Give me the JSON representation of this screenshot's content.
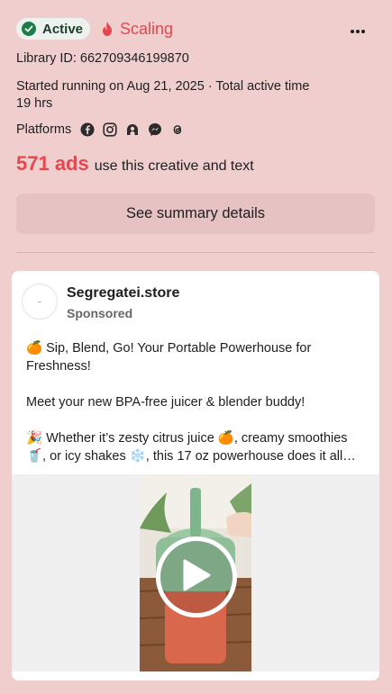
{
  "status": {
    "active_label": "Active",
    "scaling_label": "Scaling",
    "more_icon": "more-horizontal-icon"
  },
  "details": {
    "library_id": "Library ID: 662709346199870",
    "started_line1": "Started running on Aug 21, 2025 · Total active time",
    "started_line2": "19 hrs",
    "platforms_label": "Platforms",
    "platform_icons": [
      "facebook-icon",
      "instagram-icon",
      "audience-network-icon",
      "messenger-icon",
      "threads-icon"
    ]
  },
  "ads": {
    "count": "571 ads",
    "rest": "use this creative and text"
  },
  "summary_button": "See summary details",
  "ad": {
    "page_name": "Segregatei.store",
    "sponsored": "Sponsored",
    "body": [
      "🍊 Sip, Blend, Go! Your Portable Powerhouse for",
      "Freshness!",
      "",
      "Meet your new BPA-free juicer & blender buddy!",
      "",
      "🎉 Whether it’s zesty citrus juice 🍊, creamy smoothies",
      "🥤, or icy shakes ❄️, this 17 oz powerhouse does it all…"
    ]
  },
  "colors": {
    "background": "#f1cece",
    "accent_red": "#e2484e",
    "active_green": "#1c7c4a"
  }
}
